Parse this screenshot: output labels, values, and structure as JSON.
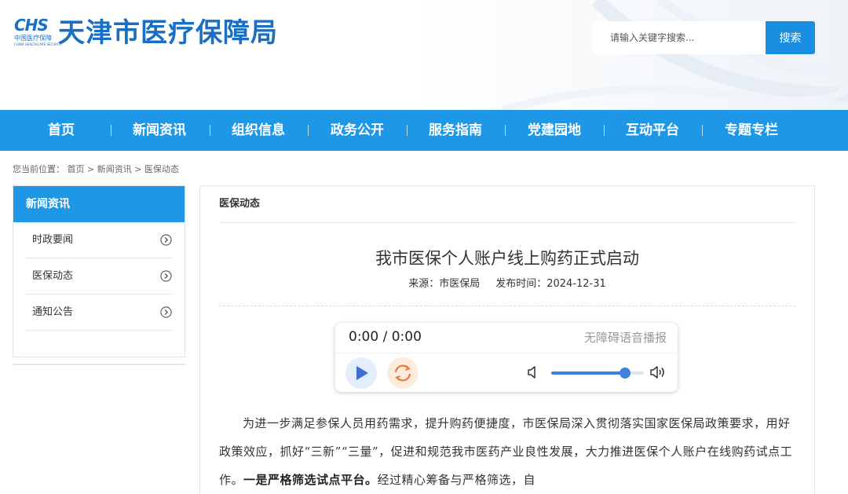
{
  "header": {
    "logo_mark": "CHS",
    "logo_sub1": "中国医疗保障",
    "logo_sub2": "CHINA HEALTHCARE SECURITY",
    "site_title": "天津市医疗保障局"
  },
  "search": {
    "placeholder": "请输入关键字搜索...",
    "button_label": "搜索"
  },
  "nav": {
    "items": [
      "首页",
      "新闻资讯",
      "组织信息",
      "政务公开",
      "服务指南",
      "党建园地",
      "互动平台",
      "专题专栏"
    ]
  },
  "breadcrumb": {
    "prefix": "您当前位置：",
    "path": "首页 > 新闻资讯 > 医保动态"
  },
  "sidebar": {
    "title": "新闻资讯",
    "items": [
      {
        "label": "时政要闻"
      },
      {
        "label": "医保动态"
      },
      {
        "label": "通知公告"
      }
    ]
  },
  "main": {
    "section_title": "医保动态",
    "article": {
      "title": "我市医保个人账户线上购药正式启动",
      "source": "来源：市医保局",
      "date": "发布时间：2024-12-31",
      "body_part1": "为进一步满足参保人员用药需求，提升购药便捷度，市医保局深入贯彻落实国家医保局政策要求，用好政策效应，抓好“三新”“三量”，促进和规范我市医药产业良性发展，大力推进医保个人账户在线购药试点工作。",
      "body_bold": "一是严格筛选试点平台。",
      "body_part2": "经过精心筹备与严格筛选，自"
    }
  },
  "player": {
    "time": "0:00 / 0:00",
    "label": "无障碍语音播报",
    "volume": 0.8
  },
  "colors": {
    "brand_blue": "#1a6fc4",
    "nav_blue": "#1e97e6",
    "player_accent": "#3e82e0"
  }
}
